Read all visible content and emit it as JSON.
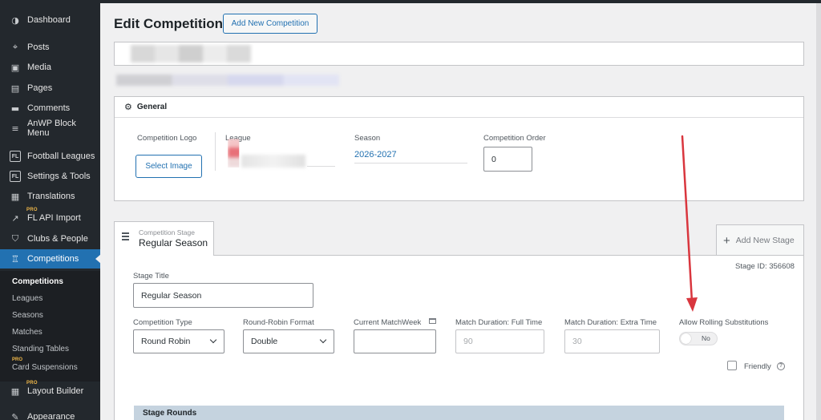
{
  "sidebar": {
    "items": [
      {
        "label": "Dashboard",
        "icon": "dashboard-icon",
        "glyph": "◑"
      },
      {
        "label": "Posts",
        "icon": "pin-icon",
        "glyph": "⌖"
      },
      {
        "label": "Media",
        "icon": "media-icon",
        "glyph": "▣"
      },
      {
        "label": "Pages",
        "icon": "pages-icon",
        "glyph": "▤"
      },
      {
        "label": "Comments",
        "icon": "comments-icon",
        "glyph": "▬"
      },
      {
        "label": "AnWP Block Menu",
        "icon": "menu-icon",
        "glyph": "≡"
      },
      {
        "label": "Football Leagues",
        "icon": "fl-icon",
        "glyph": "FL"
      },
      {
        "label": "Settings & Tools",
        "icon": "fl-icon",
        "glyph": "FL"
      },
      {
        "label": "Translations",
        "icon": "translations-icon",
        "glyph": "▦"
      },
      {
        "label": "FL API Import",
        "icon": "api-icon",
        "glyph": "↗",
        "badge": "PRO"
      },
      {
        "label": "Clubs & People",
        "icon": "shield-icon",
        "glyph": "⛉"
      },
      {
        "label": "Competitions",
        "icon": "trophy-icon",
        "glyph": "♖"
      }
    ],
    "submenu": [
      {
        "label": "Competitions"
      },
      {
        "label": "Leagues"
      },
      {
        "label": "Seasons"
      },
      {
        "label": "Matches"
      },
      {
        "label": "Standing Tables"
      },
      {
        "label": "Card Suspensions",
        "badge": "PRO"
      }
    ],
    "after": [
      {
        "label": "Layout Builder",
        "icon": "layout-icon",
        "glyph": "▦",
        "badge": "PRO"
      },
      {
        "label": "Appearance",
        "icon": "brush-icon",
        "glyph": "✎"
      }
    ]
  },
  "header": {
    "title": "Edit Competition",
    "add_new_label": "Add New Competition"
  },
  "general": {
    "heading": "General",
    "logo_label": "Competition Logo",
    "select_image_label": "Select Image",
    "league_label": "League",
    "season_label": "Season",
    "season_value": "2026-2027",
    "order_label": "Competition Order",
    "order_value": "0"
  },
  "stage": {
    "small_label": "Competition Stage",
    "name": "Regular Season",
    "add_new_stage": "Add New Stage",
    "stage_id": "Stage ID: 356608",
    "title_label": "Stage Title",
    "title_value": "Regular Season",
    "type_label": "Competition Type",
    "type_value": "Round Robin",
    "format_label": "Round-Robin Format",
    "format_value": "Double",
    "matchweek_label": "Current MatchWeek",
    "matchweek_value": "",
    "full_time_label": "Match Duration: Full Time",
    "full_time_value": "90",
    "extra_time_label": "Match Duration: Extra Time",
    "extra_time_value": "30",
    "rolling_label": "Allow Rolling Substitutions",
    "rolling_value": "No",
    "friendly_label": "Friendly",
    "rounds_heading": "Stage Rounds"
  },
  "colors": {
    "accent": "#2271b1",
    "sidebar_bg": "#23282d",
    "annotation_arrow": "#d9363e"
  }
}
